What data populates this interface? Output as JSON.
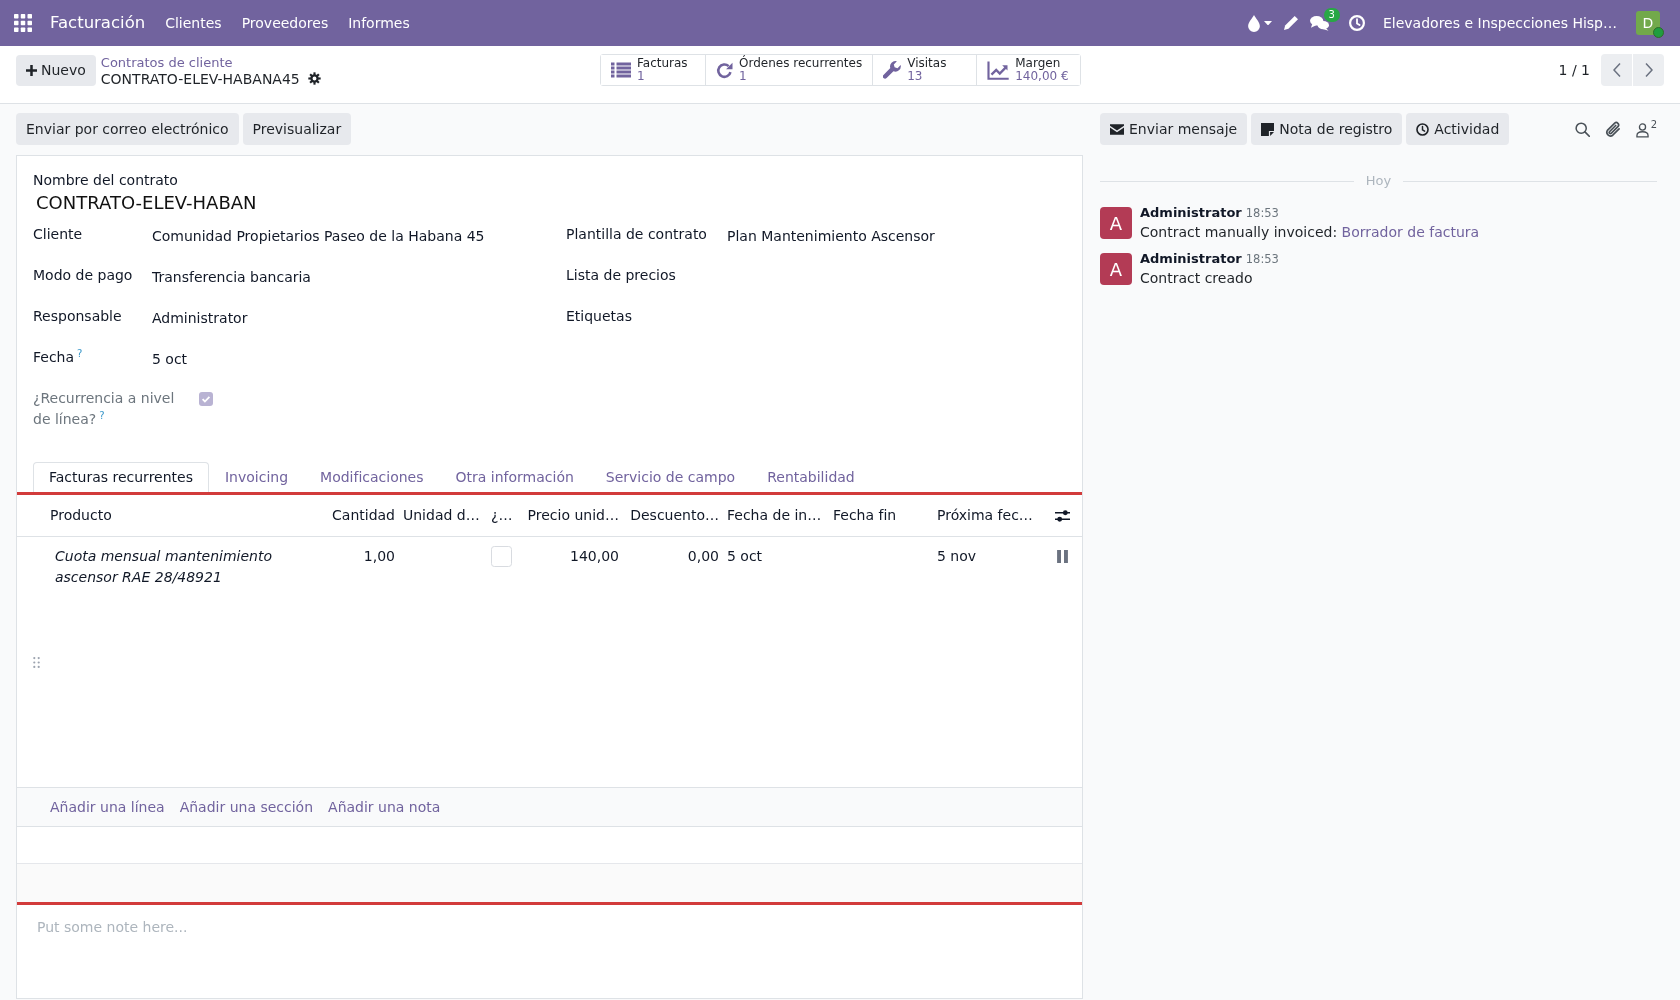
{
  "navbar": {
    "app_name": "Facturación",
    "menu": [
      "Clientes",
      "Proveedores",
      "Informes"
    ],
    "messages_count": "3",
    "company": "Elevadores e Inspecciones Hisp…",
    "user": {
      "initial": "D",
      "online": true
    }
  },
  "control_panel": {
    "new_button": "Nuevo",
    "breadcrumb": "Contratos de cliente",
    "record_name": "CONTRATO-ELEV-HABANA45",
    "smart_buttons": [
      {
        "label": "Facturas",
        "value": "1"
      },
      {
        "label": "Órdenes recurrentes",
        "value": "1"
      },
      {
        "label": "Visitas",
        "value": "13"
      },
      {
        "label": "Margen",
        "value": "140,00 €"
      }
    ],
    "pager": "1 / 1"
  },
  "action_buttons": [
    "Enviar por correo electrónico",
    "Previsualizar"
  ],
  "form": {
    "title_label": "Nombre del contrato",
    "title_value": "CONTRATO-ELEV-HABAN",
    "left_fields": [
      {
        "kind": "text",
        "label": "Cliente",
        "value": "Comunidad Propietarios Paseo de la Habana 45"
      },
      {
        "kind": "text",
        "label": "Modo de pago",
        "value": "Transferencia bancaria"
      },
      {
        "kind": "text",
        "label": "Responsable",
        "value": "Administrator"
      },
      {
        "kind": "text",
        "label": "Fecha",
        "help": "?",
        "value": "5 oct"
      },
      {
        "kind": "checkbox",
        "label": "¿Recurrencia a nivel de línea?",
        "help": "?",
        "checked": true,
        "readonly": true
      }
    ],
    "right_fields": [
      {
        "kind": "text",
        "label": "Plantilla de contrato",
        "value": "Plan Mantenimiento Ascensor"
      },
      {
        "kind": "text",
        "label": "Lista de precios"
      },
      {
        "kind": "text",
        "label": "Etiquetas"
      }
    ],
    "tabs": [
      {
        "label": "Facturas recurrentes",
        "selected": true
      },
      {
        "label": "Invoicing",
        "selected": false
      },
      {
        "label": "Modificaciones",
        "selected": false
      },
      {
        "label": "Otra información",
        "selected": false
      },
      {
        "label": "Servicio de campo",
        "selected": false
      },
      {
        "label": "Rentabilidad",
        "selected": false
      }
    ],
    "lines": {
      "columns": [
        {
          "label": "Producto",
          "kind": "description"
        },
        {
          "label": "Cantidad",
          "kind": "number"
        },
        {
          "label": "Unidad d…",
          "kind": "text"
        },
        {
          "label": "¿…",
          "kind": "checkbox"
        },
        {
          "label": "Precio unid…",
          "kind": "number"
        },
        {
          "label": "Descuento…",
          "kind": "number"
        },
        {
          "label": "Fecha de in…",
          "kind": "text"
        },
        {
          "label": "Fecha fin",
          "kind": "text"
        },
        {
          "label": "Próxima fec…",
          "kind": "text"
        }
      ],
      "rows": [
        {
          "product": "Cuota mensual mantenimiento ascensor RAE 28/48921",
          "quantity": "1,00",
          "checked": false,
          "unit_price": "140,00",
          "discount": "0,00",
          "start_date": "5 oct",
          "next_date": "5 nov"
        }
      ],
      "add_links": [
        "Añadir una línea",
        "Añadir una sección",
        "Añadir una nota"
      ]
    },
    "note": {
      "placeholder": "Put some note here..."
    }
  },
  "chatter": {
    "buttons": [
      "Enviar mensaje",
      "Nota de registro",
      "Actividad"
    ],
    "followers_count": "2",
    "date_separator": "Hoy",
    "messages": [
      {
        "avatar": "A",
        "author": "Administrator",
        "time": "18:53",
        "text": "Contract manually invoiced:",
        "link": "Borrador de factura"
      },
      {
        "avatar": "A",
        "author": "Administrator",
        "time": "18:53",
        "text": "Contract creado"
      }
    ]
  }
}
